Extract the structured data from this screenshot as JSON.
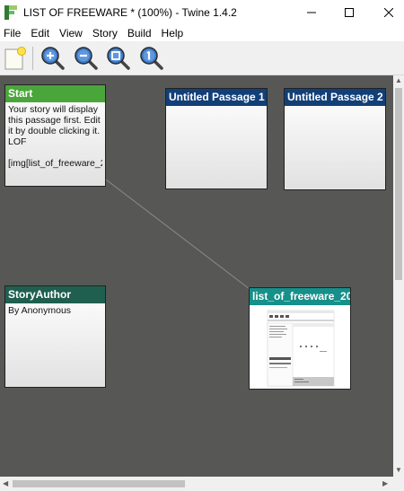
{
  "window": {
    "title": "LIST OF FREEWARE * (100%) - Twine 1.4.2"
  },
  "menu": {
    "items": [
      "File",
      "Edit",
      "View",
      "Story",
      "Build",
      "Help"
    ]
  },
  "toolbar": {
    "buttons": [
      "new-passage-icon",
      "zoom-in-icon",
      "zoom-out-icon",
      "zoom-fit-icon",
      "zoom-actual-size-icon"
    ]
  },
  "passages": {
    "start": {
      "title": "Start",
      "color": "#4aa63a",
      "lines": [
        "Your story will display",
        "this passage first. Edit",
        "it by double clicking it.",
        "LOF",
        "",
        "[img[list_of_freeware_2"
      ]
    },
    "untitled1": {
      "title": "Untitled Passage 1",
      "color": "#123f77"
    },
    "untitled2": {
      "title": "Untitled Passage 2",
      "color": "#123f77"
    },
    "author": {
      "title": "StoryAuthor",
      "color": "#1f5f4f",
      "lines": [
        "By Anonymous"
      ]
    },
    "image": {
      "title": "list_of_freeware_20",
      "color": "#16908a"
    }
  }
}
